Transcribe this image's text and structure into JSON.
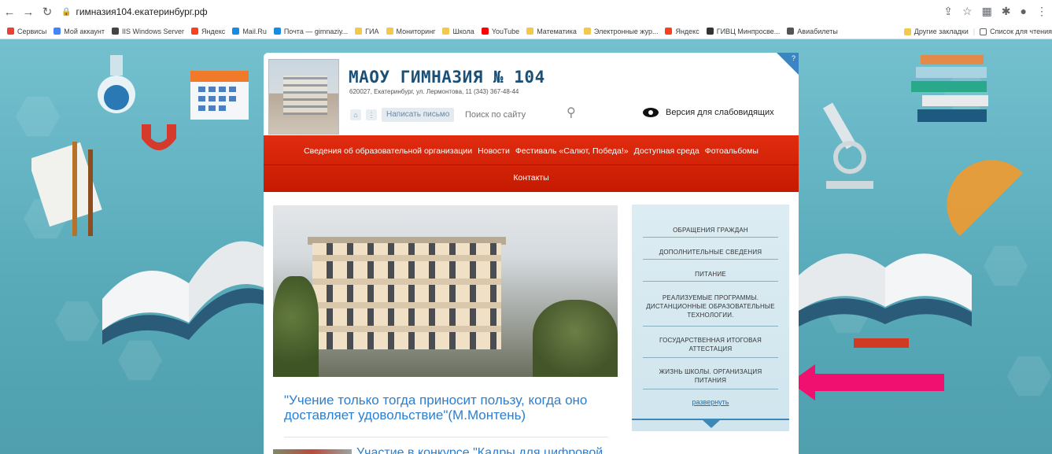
{
  "browser": {
    "address": "гимназия104.екатеринбург.рф",
    "bookmarks": [
      {
        "label": "Сервисы",
        "color": "#e94235"
      },
      {
        "label": "Мой аккаунт",
        "color": "#4285f4"
      },
      {
        "label": "IIS Windows Server",
        "color": "#444444"
      },
      {
        "label": "Яндекс",
        "color": "#fc3f1d"
      },
      {
        "label": "Mail.Ru",
        "color": "#168de2"
      },
      {
        "label": "Почта — gimnaziy...",
        "color": "#168de2"
      },
      {
        "label": "ГИА",
        "color": "#f2c94c"
      },
      {
        "label": "Мониторинг",
        "color": "#f2c94c"
      },
      {
        "label": "Школа",
        "color": "#f2c94c"
      },
      {
        "label": "YouTube",
        "color": "#ff0000"
      },
      {
        "label": "Математика",
        "color": "#f2c94c"
      },
      {
        "label": "Электронные жур...",
        "color": "#f2c94c"
      },
      {
        "label": "Яндекс",
        "color": "#fc3f1d"
      },
      {
        "label": "ГИВЦ Минпросве...",
        "color": "#333333"
      },
      {
        "label": "Авиабилеты",
        "color": "#555555"
      }
    ],
    "other_bookmarks": "Другие закладки",
    "reading_list": "Список для чтения"
  },
  "site": {
    "title": "МАОУ ГИМНАЗИЯ № 104",
    "address": "620027, Екатеринбург, ул. Лермонтова, 11   (343) 367-48-44",
    "write_letter": "Написать письмо",
    "search_placeholder": "Поиск по сайту",
    "vision_version": "Версия для слабовидящих",
    "menu_row1": [
      "Сведения об образовательной организации",
      "Новости",
      "Фестиваль «Салют, Победа!»",
      "Доступная среда",
      "Фотоальбомы"
    ],
    "menu_row2": [
      "Контакты"
    ],
    "quote": "\"Учение только тогда приносит пользу, когда оно доставляет удовольствие\"(М.Монтень)",
    "news_title": "Участие в конкурсе \"Кадры для цифровой",
    "sidebar": {
      "items": [
        "ОБРАЩЕНИЯ ГРАЖДАН",
        "ДОПОЛНИТЕЛЬНЫЕ СВЕДЕНИЯ",
        "ПИТАНИЕ",
        "РЕАЛИЗУЕМЫЕ ПРОГРАММЫ. ДИСТАНЦИОННЫЕ ОБРАЗОВАТЕЛЬНЫЕ ТЕХНОЛОГИИ.",
        "ГОСУДАРСТВЕННАЯ ИТОГОВАЯ АТТЕСТАЦИЯ",
        "ЖИЗНЬ ШКОЛЫ. ОРГАНИЗАЦИЯ ПИТАНИЯ"
      ],
      "expand": "развернуть"
    }
  },
  "colors": {
    "menu": "#d42306",
    "title": "#1c4f76",
    "link": "#2b7fd0",
    "annotation_arrow": "#f0106f"
  }
}
